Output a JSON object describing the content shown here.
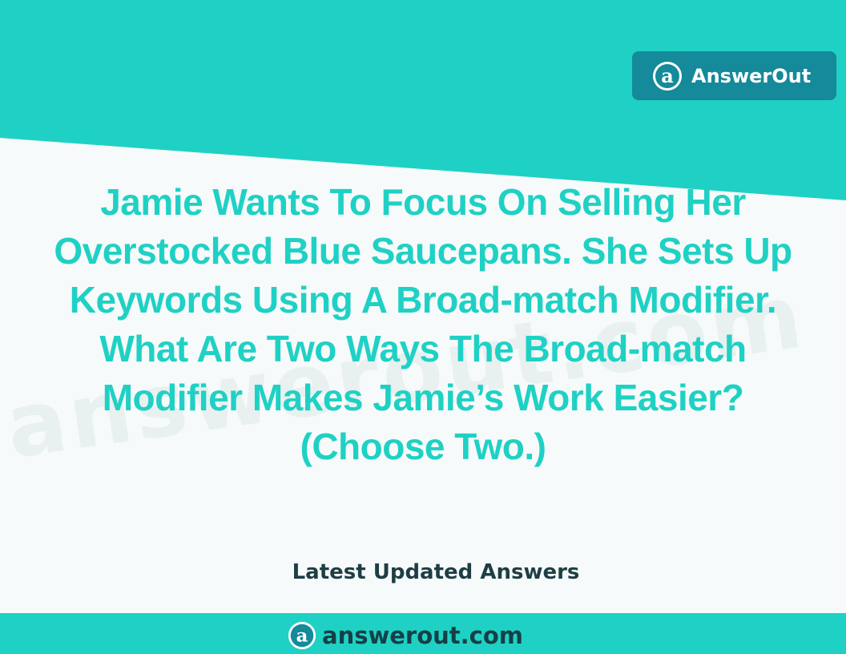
{
  "brand": {
    "name": "AnswerOut",
    "logo_icon": "at-sign-logo-icon",
    "logo_letter": "a"
  },
  "watermark": {
    "text": "answerout.com"
  },
  "question": {
    "lines": [
      "Jamie Wants To Focus On Selling Her",
      "Overstocked Blue Saucepans. She Sets Up",
      "Keywords Using A Broad-match Modifier.",
      "What Are Two Ways The Broad-match",
      "Modifier Makes Jamie’s Work Easier?",
      "(Choose Two.)"
    ]
  },
  "tagline": "Latest Updated Answers",
  "footer": {
    "site": "answerout.com",
    "logo_letter": "a"
  },
  "colors": {
    "accent": "#1fd1c4",
    "badge": "#148a9a",
    "dark_text": "#1e3e45",
    "background": "#f7fafa"
  }
}
